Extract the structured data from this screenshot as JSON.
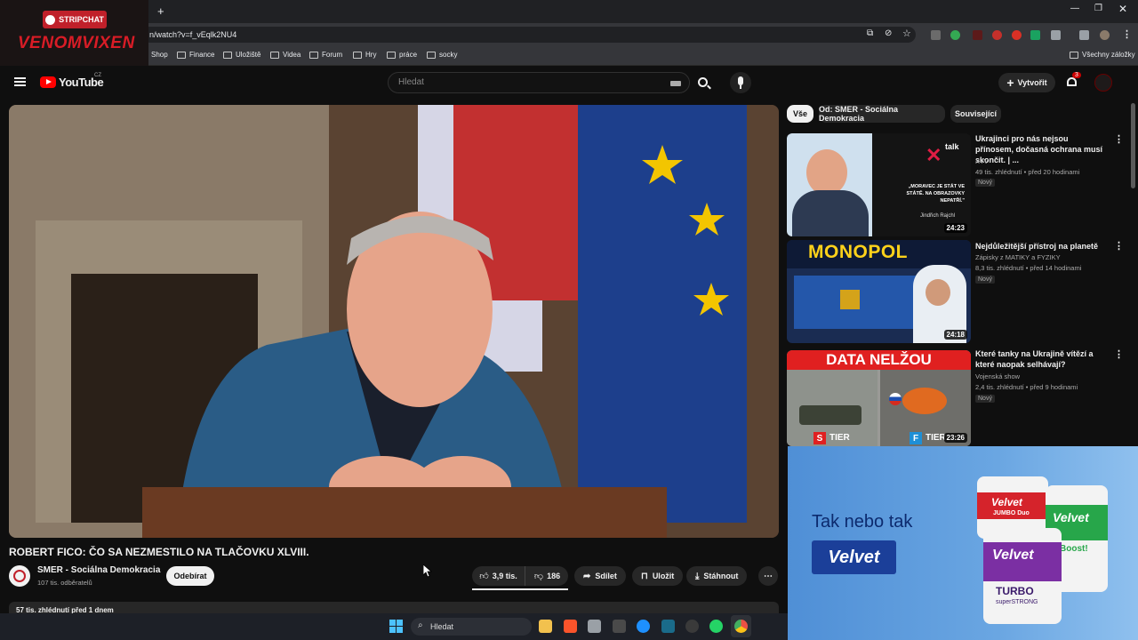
{
  "browser": {
    "url": "n/watch?v=f_vEqlk2NU4",
    "new_tab_label": "+",
    "bookmarks": [
      "Shop",
      "Finance",
      "Uložiště",
      "Videa",
      "Forum",
      "Hry",
      "práce",
      "socky"
    ],
    "all_bookmarks": "Všechny záložky"
  },
  "overlay": {
    "brand": "STRIPCHAT",
    "name": "VENOMVIXEN"
  },
  "youtube": {
    "logo_text": "YouTube",
    "logo_region": "CZ",
    "search_placeholder": "Hledat",
    "create_label": "Vytvořit",
    "notif_count": "3"
  },
  "filters": [
    "Vše",
    "Od: SMER - Sociálna Demokracia",
    "Související"
  ],
  "video": {
    "title": "ROBERT FICO: ČO SA NEZMESTILO NA TLAČOVKU XLVIII.",
    "channel": "SMER - Sociálna Demokracia",
    "subscribers": "107 tis. odběratelů",
    "subscribe_label": "Odebírat",
    "likes": "3,9 tis.",
    "dislikes": "186",
    "share_label": "Sdílet",
    "save_label": "Uložit",
    "download_label": "Stáhnout",
    "description_meta": "57 tis. zhlédnutí před 1 dnem"
  },
  "related": [
    {
      "title": "Ukrajinci pro nás nejsou přínosem, dočasná ochrana musí skončit. | ...",
      "channel": "XTV",
      "meta": "49 tis. zhlédnutí • před 20 hodinami",
      "badge": "Nový",
      "duration": "24:23",
      "thumb_brand": "talk",
      "thumb_quote": "„MORAVEC JE STÁT VE STÁTĚ. NA OBRAZOVKY NEPATŘÍ.\"",
      "thumb_name": "Jindřich Rajchl"
    },
    {
      "title": "Nejdůležitější přístroj na planetě",
      "channel": "Zápisky z MATIKY a FYZIKY",
      "meta": "8,3 tis. zhlédnutí • před 14 hodinami",
      "badge": "Nový",
      "duration": "24:18",
      "thumb_text": "MONOPOL"
    },
    {
      "title": "Které tanky na Ukrajině vítězí a které naopak selhávají?",
      "channel": "Vojenská show",
      "meta": "2,4 tis. zhlédnutí • před 9 hodinami",
      "badge": "Nový",
      "duration": "23:26",
      "thumb_text": "DATA NELŽOU",
      "tier_left": "TIER",
      "tier_left_letter": "S",
      "tier_right": "TIER",
      "tier_right_letter": "F"
    }
  ],
  "ad": {
    "headline": "Tak nebo tak",
    "brand": "Velvet",
    "product_1": "JUMBO Duo",
    "product_2": "Boost!",
    "product_3": "TURBO",
    "product_3_sub": "superSTRONG"
  },
  "taskbar": {
    "search_label": "Hledat"
  }
}
